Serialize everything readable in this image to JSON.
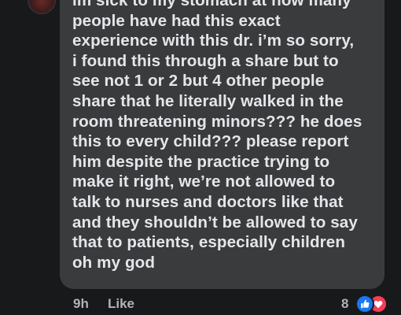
{
  "comment": {
    "lines": [
      "im sick to my stomach at how many",
      "people have had this exact",
      "experience with this dr. i’m so sorry,",
      "i found this through a share but to",
      "see not 1 or 2 but 4 other people",
      "share that he literally walked in the",
      "room threatening minors??? he does",
      "this to every child??? please report",
      "him despite the practice trying to",
      "make it right, we’re not allowed to",
      "talk to nurses and doctors like that",
      "and they shouldn’t be allowed to say",
      "that to patients, especially children",
      "oh my god"
    ]
  },
  "footer": {
    "timestamp": "9h",
    "like_label": "Like",
    "reaction_count": "8",
    "reactions": [
      "like-icon",
      "love-icon"
    ]
  },
  "colors": {
    "background": "#18191a",
    "bubble": "#3a3b3c",
    "text": "#e4e6eb",
    "secondary_text": "#b0b3b8",
    "like_blue": "#1877f2",
    "love_red": "#f33e58"
  }
}
